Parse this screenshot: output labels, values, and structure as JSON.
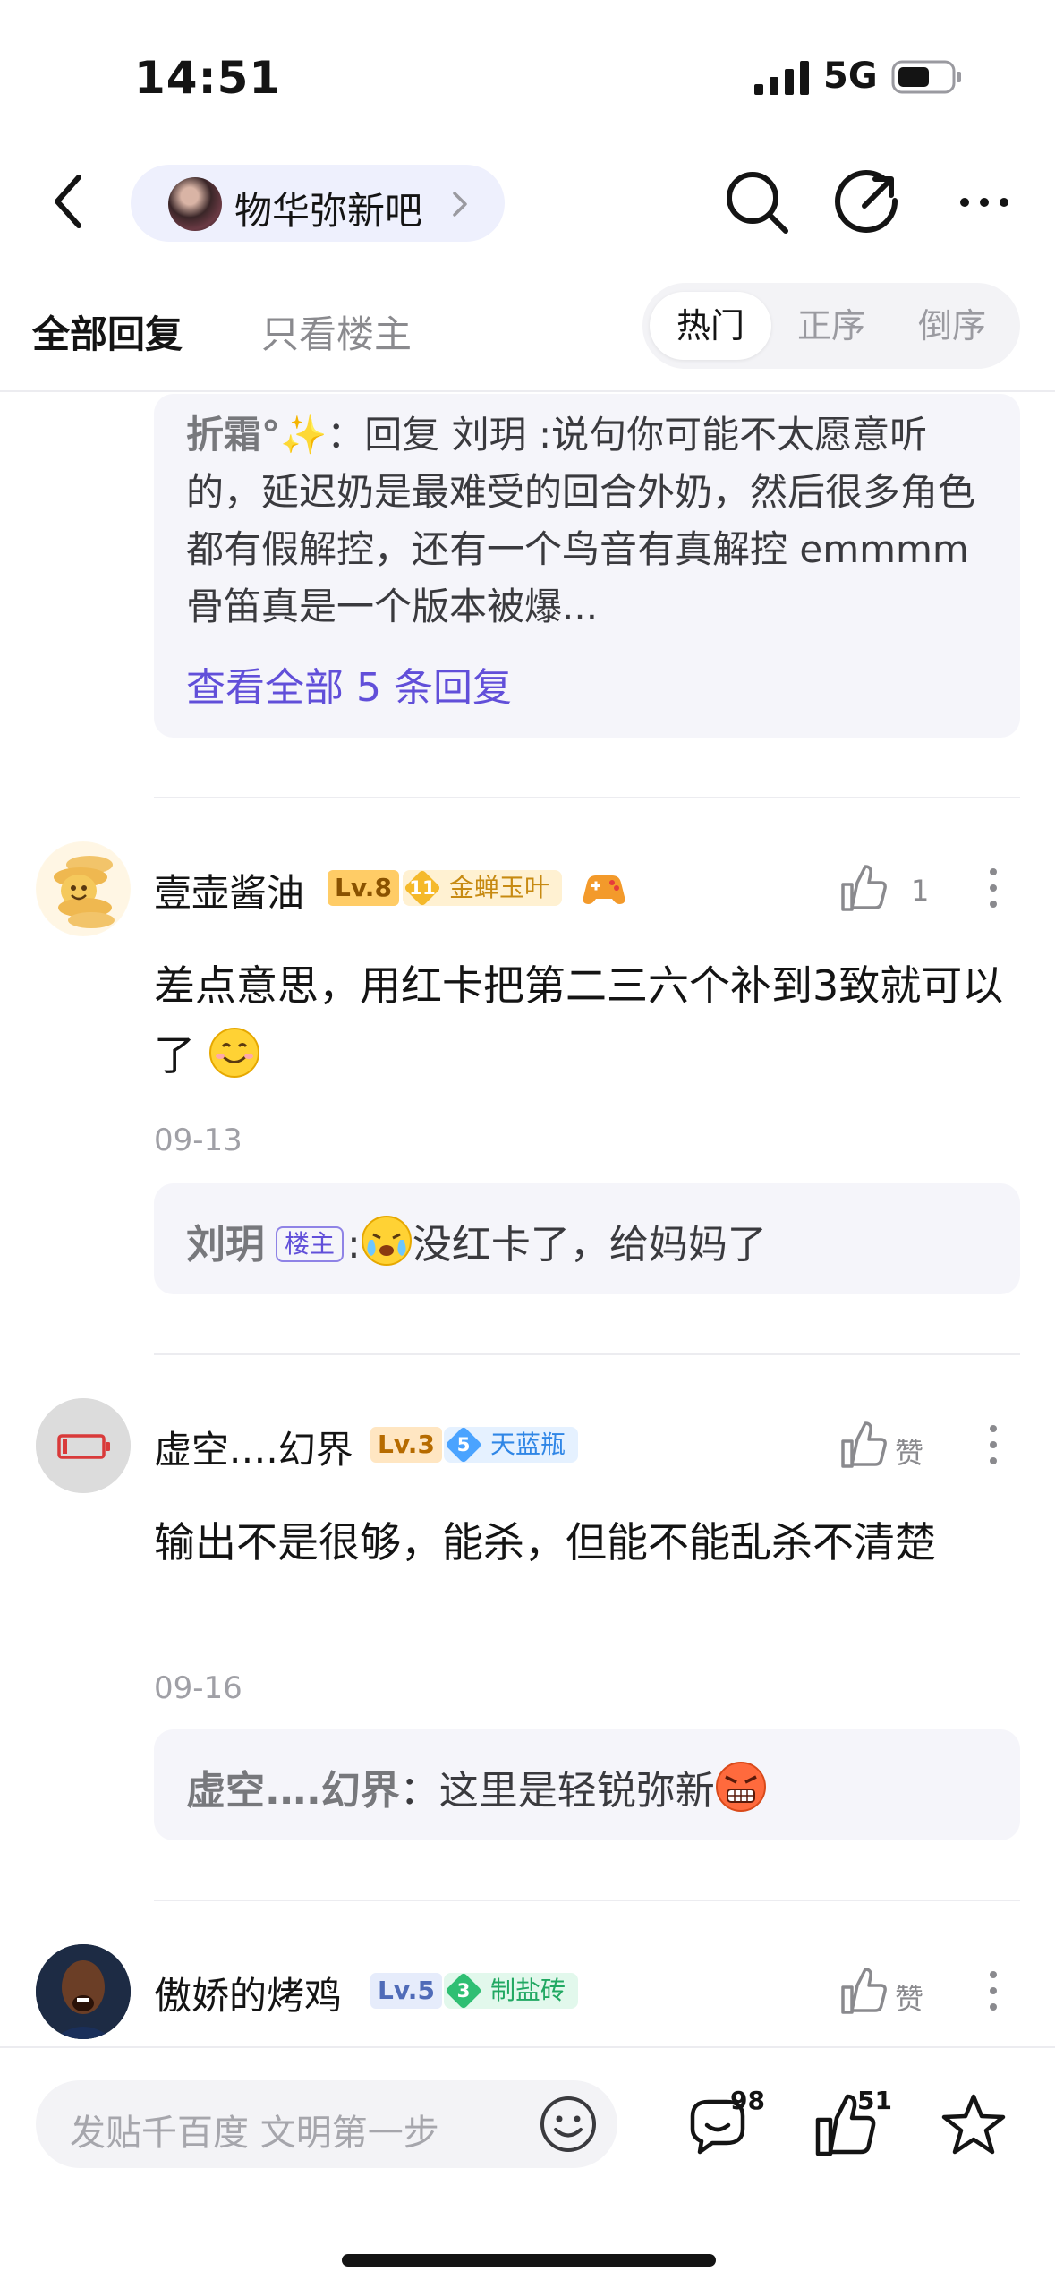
{
  "status_bar": {
    "time": "14:51",
    "network": "5G"
  },
  "header": {
    "forum_name": "物华弥新吧"
  },
  "filter": {
    "all_replies": "全部回复",
    "op_only": "只看楼主",
    "sort_options": [
      "热门",
      "正序",
      "倒序"
    ],
    "active_sort": "热门"
  },
  "top_reply_box": {
    "author": "折霜°✨",
    "text": "：回复 刘玥 :说句你可能不太愿意听的，延迟奶是最难受的回合外奶，然后很多角色都有假解控，还有一个鸟音有真解控 emmmm 骨笛真是一个版本被爆...",
    "see_all": "查看全部 5 条回复"
  },
  "comments": [
    {
      "username": "壹壶酱油",
      "level": "Lv.8",
      "honor_num": "11",
      "honor_title": "金蝉玉叶",
      "likes": "1",
      "text": "差点意思，用红卡把第二三六个补到3致就可以了",
      "date": "09-13",
      "reply": {
        "author": "刘玥",
        "tag": "楼主",
        "text": "没红卡了，给妈妈了"
      }
    },
    {
      "username": "虚空.‥.幻界",
      "level": "Lv.3",
      "honor_num": "5",
      "honor_title": "天蓝瓶",
      "likes": "赞",
      "text": "输出不是很够，能杀，但能不能乱杀不清楚",
      "date": "09-16",
      "reply": {
        "author": "虚空.‥.幻界",
        "text": "这里是轻锐弥新"
      }
    },
    {
      "username": "傲娇的烤鸡",
      "level": "Lv.5",
      "honor_num": "3",
      "honor_title": "制盐砖",
      "likes": "赞"
    }
  ],
  "bottom_bar": {
    "input_placeholder": "发贴千百度 文明第一步",
    "comment_count": "98",
    "like_count": "51"
  },
  "colors": {
    "accent": "#614fd9",
    "reply_bg": "#f5f5fa",
    "divider": "#ececf0"
  }
}
